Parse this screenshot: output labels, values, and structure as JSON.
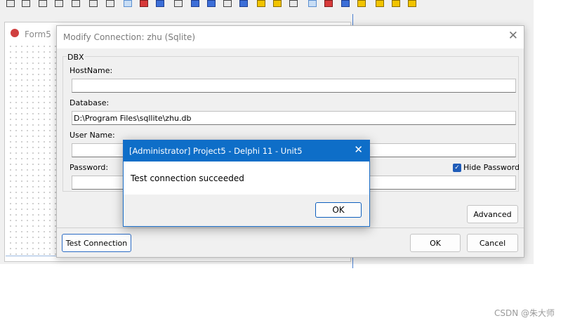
{
  "form5": {
    "title": "Form5"
  },
  "conn_dialog": {
    "title": "Modify Connection: zhu (Sqlite)",
    "group_label": "DBX",
    "hostname_label": "HostName:",
    "hostname_value": "",
    "database_label": "Database:",
    "database_value": "D:\\Program Files\\sqllite\\zhu.db",
    "username_label": "User Name:",
    "username_value": "",
    "password_label": "Password:",
    "password_value": "",
    "hide_password_label": "Hide Password",
    "hide_password_checked": true,
    "advanced_button": "Advanced",
    "test_connection_button": "Test Connection",
    "ok_button": "OK",
    "cancel_button": "Cancel"
  },
  "message_box": {
    "title": "[Administrator] Project5 - Delphi 11 - Unit5",
    "message": "Test connection succeeded",
    "ok_button": "OK"
  },
  "watermark": "CSDN @朱大师",
  "colors": {
    "message_titlebar": "#0e6ec8",
    "checkbox": "#1f5cb8",
    "focus_border": "#2b6bc4"
  }
}
